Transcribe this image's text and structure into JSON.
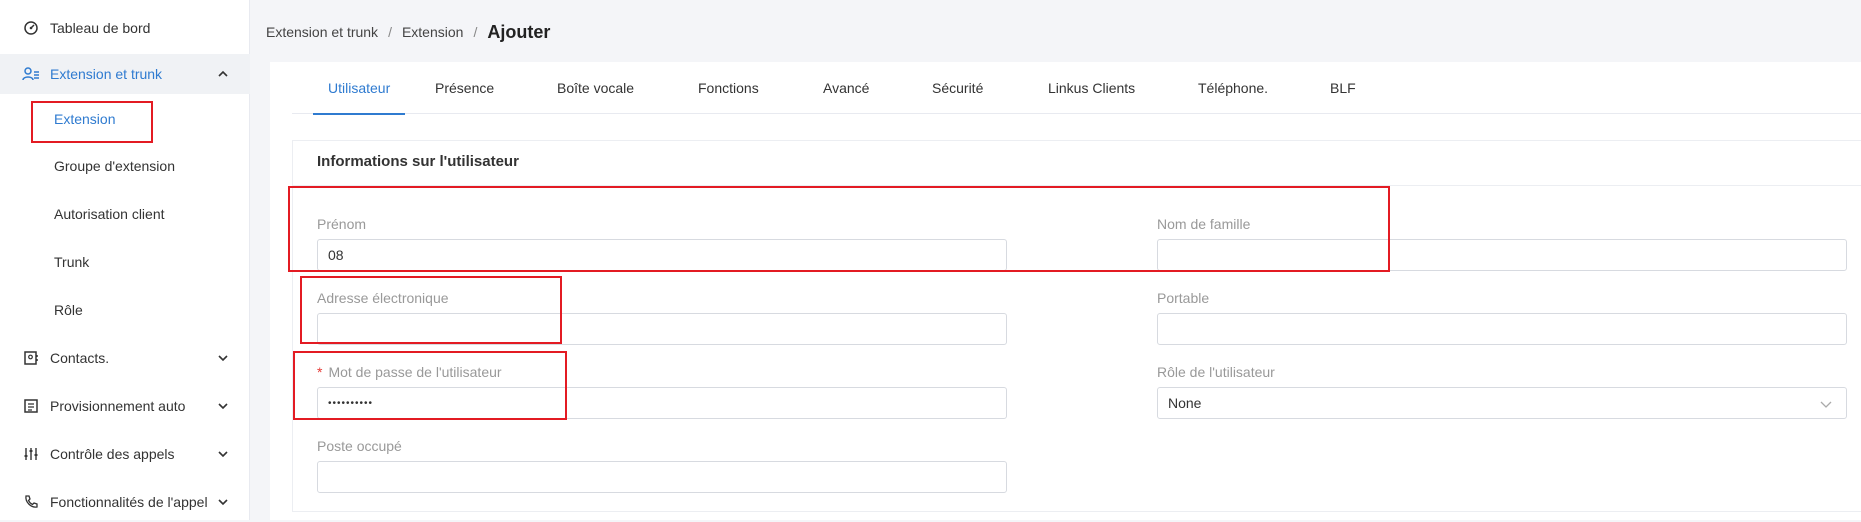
{
  "sidebar": {
    "items": [
      {
        "label": "Tableau de bord"
      },
      {
        "label": "Extension et trunk"
      },
      {
        "label": "Contacts."
      },
      {
        "label": "Provisionnement auto"
      },
      {
        "label": "Contrôle des appels"
      },
      {
        "label": "Fonctionnalités de l'appel"
      }
    ],
    "subitems": [
      {
        "label": "Extension"
      },
      {
        "label": "Groupe d'extension"
      },
      {
        "label": "Autorisation client"
      },
      {
        "label": "Trunk"
      },
      {
        "label": "Rôle"
      }
    ]
  },
  "breadcrumb": {
    "level1": "Extension et trunk",
    "level2": "Extension",
    "current": "Ajouter",
    "separator": "/"
  },
  "tabs": [
    {
      "label": "Utilisateur"
    },
    {
      "label": "Présence"
    },
    {
      "label": "Boîte vocale"
    },
    {
      "label": "Fonctions"
    },
    {
      "label": "Avancé"
    },
    {
      "label": "Sécurité"
    },
    {
      "label": "Linkus Clients"
    },
    {
      "label": "Téléphone."
    },
    {
      "label": "BLF"
    }
  ],
  "form": {
    "section_title": "Informations sur l'utilisateur",
    "first_name": {
      "label": "Prénom",
      "value": "08"
    },
    "last_name": {
      "label": "Nom de famille",
      "value": ""
    },
    "email": {
      "label": "Adresse électronique",
      "value": ""
    },
    "mobile": {
      "label": "Portable",
      "value": ""
    },
    "password": {
      "label": "Mot de passe de l'utilisateur",
      "required_mark": "*",
      "value": "••••••••••"
    },
    "role": {
      "label": "Rôle de l'utilisateur",
      "value": "None"
    },
    "busy_station": {
      "label": "Poste occupé",
      "value": ""
    }
  },
  "colors": {
    "accent": "#2f7bd0",
    "annotation": "#e31b23",
    "required": "#e53935"
  }
}
